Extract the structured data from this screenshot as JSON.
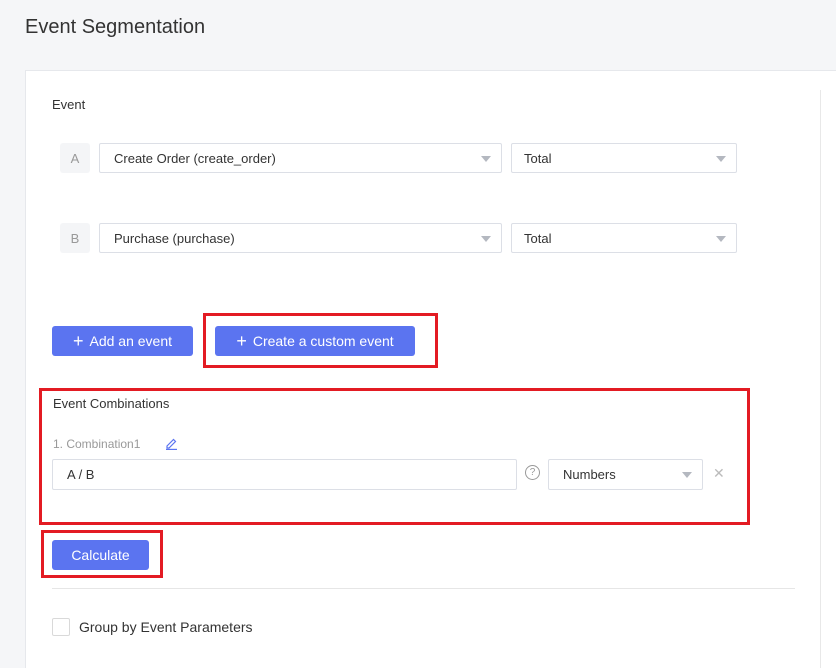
{
  "header": {
    "title": "Event Segmentation"
  },
  "event_section": {
    "label": "Event",
    "events": [
      {
        "letter": "A",
        "event": "Create Order (create_order)",
        "metric": "Total"
      },
      {
        "letter": "B",
        "event": "Purchase (purchase)",
        "metric": "Total"
      }
    ],
    "add_event_label": "Add an event",
    "create_custom_label": "Create a custom event"
  },
  "combinations": {
    "label": "Event Combinations",
    "items": [
      {
        "name": "1. Combination1",
        "formula": "A / B",
        "format": "Numbers"
      }
    ]
  },
  "calculate_label": "Calculate",
  "group_by": {
    "label": "Group by Event Parameters",
    "checked": false
  },
  "colors": {
    "primary": "#5b74f0",
    "highlight": "#e31b23"
  }
}
